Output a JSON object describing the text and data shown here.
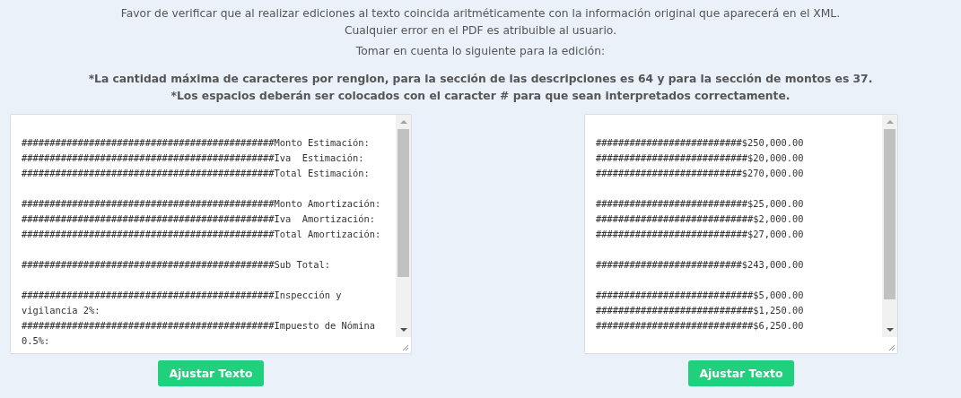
{
  "notice": {
    "lines": [
      "Favor de verificar que al realizar ediciones al texto coincida aritméticamente con la información original que aparecerá en el XML.",
      "Cualquier error en el PDF es atribuible al usuario."
    ],
    "heading": "Tomar en cuenta lo siguiente para la edición:",
    "rules": [
      "*La cantidad máxima de caracteres por renglon, para la sección de las descripciones es 64 y para la sección de montos es 37.",
      "*Los espacios deberán ser colocados con el caracter # para que sean interpretados correctamente."
    ]
  },
  "editors": [
    {
      "kind": "descriptions",
      "groups": [
        [
          "#############################################Monto Estimación:",
          "#############################################Iva  Estimación:",
          "#############################################Total Estimación:"
        ],
        [
          "#############################################Monto Amortización:",
          "#############################################Iva  Amortización:",
          "#############################################Total Amortización:"
        ],
        [
          "#############################################Sub Total:"
        ],
        [
          "#############################################Inspección y vigilancia 2%:",
          "#############################################Impuesto de Nómina 0.5%:"
        ]
      ],
      "button": "Ajustar Texto"
    },
    {
      "kind": "amounts",
      "groups": [
        [
          "##########################$250,000.00",
          "###########################$20,000.00",
          "##########################$270,000.00"
        ],
        [
          "###########################$25,000.00",
          "############################$2,000.00",
          "###########################$27,000.00"
        ],
        [
          "##########################$243,000.00"
        ],
        [
          "############################$5,000.00",
          "############################$1,250.00",
          "############################$6,250.00"
        ]
      ],
      "button": "Ajustar Texto"
    }
  ]
}
